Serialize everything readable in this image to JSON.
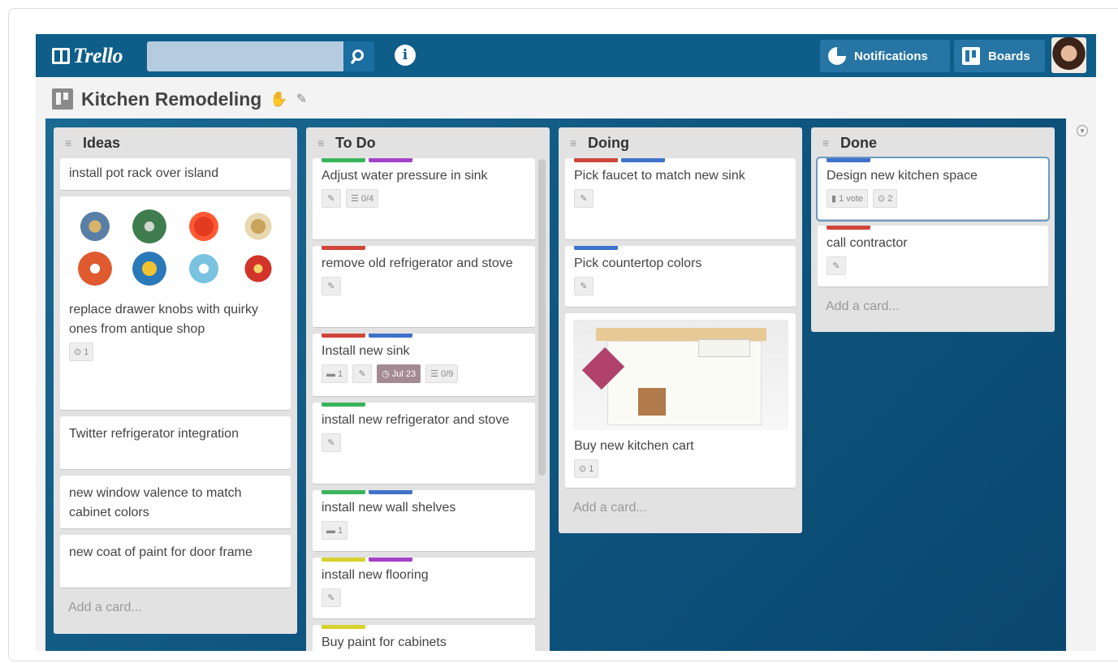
{
  "app": {
    "logo": "Trello"
  },
  "header": {
    "search": {
      "placeholder": "",
      "value": ""
    },
    "notifications_label": "Notifications",
    "boards_label": "Boards"
  },
  "board": {
    "title": "Kitchen Remodeling"
  },
  "colors": {
    "green": "#39b55a",
    "purple": "#a342c8",
    "red": "#d0453a",
    "blue": "#3f72c9",
    "yellow": "#d8d230"
  },
  "add_card_label": "Add a card...",
  "lists": [
    {
      "title": "Ideas",
      "cards": [
        {
          "text": "install pot rack over island"
        },
        {
          "text": "replace drawer knobs with quirky ones from antique shop",
          "badges": [
            "1"
          ]
        },
        {
          "text": "Twitter refrigerator integration"
        },
        {
          "text": "new window valence to match cabinet colors"
        },
        {
          "text": "new coat of paint for door frame"
        }
      ]
    },
    {
      "title": "To Do",
      "cards": [
        {
          "text": "Adjust water pressure in sink",
          "checklist": "0/4"
        },
        {
          "text": "remove old refrigerator and stove"
        },
        {
          "text": "Install new sink",
          "comments": "1",
          "due": "Jul 23",
          "checklist": "0/9"
        },
        {
          "text": "install new refrigerator and stove"
        },
        {
          "text": "install new wall shelves",
          "comments": "1"
        },
        {
          "text": "install new flooring"
        },
        {
          "text": "Buy paint for cabinets"
        }
      ]
    },
    {
      "title": "Doing",
      "cards": [
        {
          "text": "Pick faucet to match new sink"
        },
        {
          "text": "Pick countertop colors"
        },
        {
          "text": "Buy new kitchen cart",
          "attachments": "1"
        }
      ]
    },
    {
      "title": "Done",
      "cards": [
        {
          "text": "Design new kitchen space",
          "votes": "1 vote",
          "attachments": "2"
        },
        {
          "text": "call contractor"
        }
      ]
    }
  ]
}
